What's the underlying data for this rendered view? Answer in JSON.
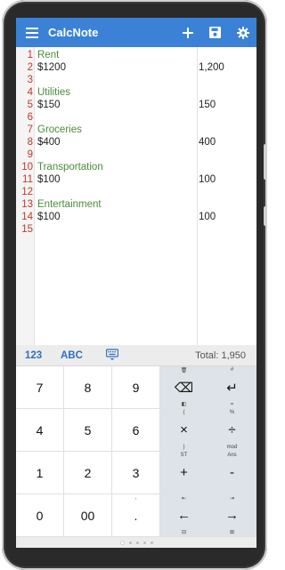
{
  "appbar": {
    "title": "CalcNote"
  },
  "icons": {
    "menu": "hamburger-icon",
    "add": "plus-icon",
    "save": "save-icon",
    "settings": "gear-icon"
  },
  "colors": {
    "appbar": "#3b82d6",
    "label": "#4a8c3a",
    "line_number": "#c0392b",
    "mode": "#2d6fc2"
  },
  "lines": [
    {
      "n": "1",
      "text": "Rent",
      "kind": "label",
      "result": ""
    },
    {
      "n": "2",
      "text": "$1200",
      "kind": "expr",
      "result": "1,200"
    },
    {
      "n": "3",
      "text": "",
      "kind": "expr",
      "result": ""
    },
    {
      "n": "4",
      "text": "Utilities",
      "kind": "label",
      "result": ""
    },
    {
      "n": "5",
      "text": "$150",
      "kind": "expr",
      "result": "150"
    },
    {
      "n": "6",
      "text": "",
      "kind": "expr",
      "result": ""
    },
    {
      "n": "7",
      "text": "Groceries",
      "kind": "label",
      "result": ""
    },
    {
      "n": "8",
      "text": "$400",
      "kind": "expr",
      "result": "400"
    },
    {
      "n": "9",
      "text": "",
      "kind": "expr",
      "result": ""
    },
    {
      "n": "10",
      "text": "Transportation",
      "kind": "label",
      "result": ""
    },
    {
      "n": "11",
      "text": "$100",
      "kind": "expr",
      "result": "100"
    },
    {
      "n": "12",
      "text": "",
      "kind": "expr",
      "result": ""
    },
    {
      "n": "13",
      "text": "Entertainment",
      "kind": "label",
      "result": ""
    },
    {
      "n": "14",
      "text": "$100",
      "kind": "expr",
      "result": "100"
    },
    {
      "n": "15",
      "text": "",
      "kind": "expr",
      "result": ""
    }
  ],
  "keyboard": {
    "mode_numeric": "123",
    "mode_alpha": "ABC",
    "total_label": "Total:",
    "total_value": "1,950",
    "keys": [
      {
        "label": "7",
        "top": "",
        "bottom": "",
        "op": false
      },
      {
        "label": "8",
        "top": "",
        "bottom": "",
        "op": false
      },
      {
        "label": "9",
        "top": "",
        "bottom": "",
        "op": false
      },
      {
        "label": "⌫",
        "top": "🗑",
        "bottom": "◧",
        "op": true,
        "name": "backspace-key"
      },
      {
        "label": "↵",
        "top": "#",
        "bottom": "=",
        "op": true,
        "name": "enter-key"
      },
      {
        "label": "4",
        "top": "",
        "bottom": "",
        "op": false
      },
      {
        "label": "5",
        "top": "",
        "bottom": "",
        "op": false
      },
      {
        "label": "6",
        "top": "",
        "bottom": "",
        "op": false
      },
      {
        "label": "×",
        "top": "(",
        "bottom": ")",
        "op": true,
        "name": "multiply-key"
      },
      {
        "label": "÷",
        "top": "%",
        "bottom": "mod",
        "op": true,
        "name": "divide-key"
      },
      {
        "label": "1",
        "top": "",
        "bottom": "",
        "op": false
      },
      {
        "label": "2",
        "top": "",
        "bottom": "",
        "op": false
      },
      {
        "label": "3",
        "top": "",
        "bottom": "",
        "op": false
      },
      {
        "label": "+",
        "top": "ST",
        "bottom": "",
        "op": true,
        "name": "plus-key"
      },
      {
        "label": "-",
        "top": "Ans",
        "bottom": "",
        "op": true,
        "name": "minus-key"
      },
      {
        "label": "0",
        "top": "",
        "bottom": "",
        "op": false
      },
      {
        "label": "00",
        "top": "",
        "bottom": "",
        "op": false
      },
      {
        "label": ".",
        "top": ",",
        "bottom": "",
        "op": false
      },
      {
        "label": "←",
        "top": "⇤",
        "bottom": "⊟",
        "op": true,
        "name": "cursor-left-key"
      },
      {
        "label": "→",
        "top": "⇥",
        "bottom": "⊞",
        "op": true,
        "name": "cursor-right-key"
      }
    ]
  },
  "pager": {
    "count": 5,
    "active": 0
  }
}
